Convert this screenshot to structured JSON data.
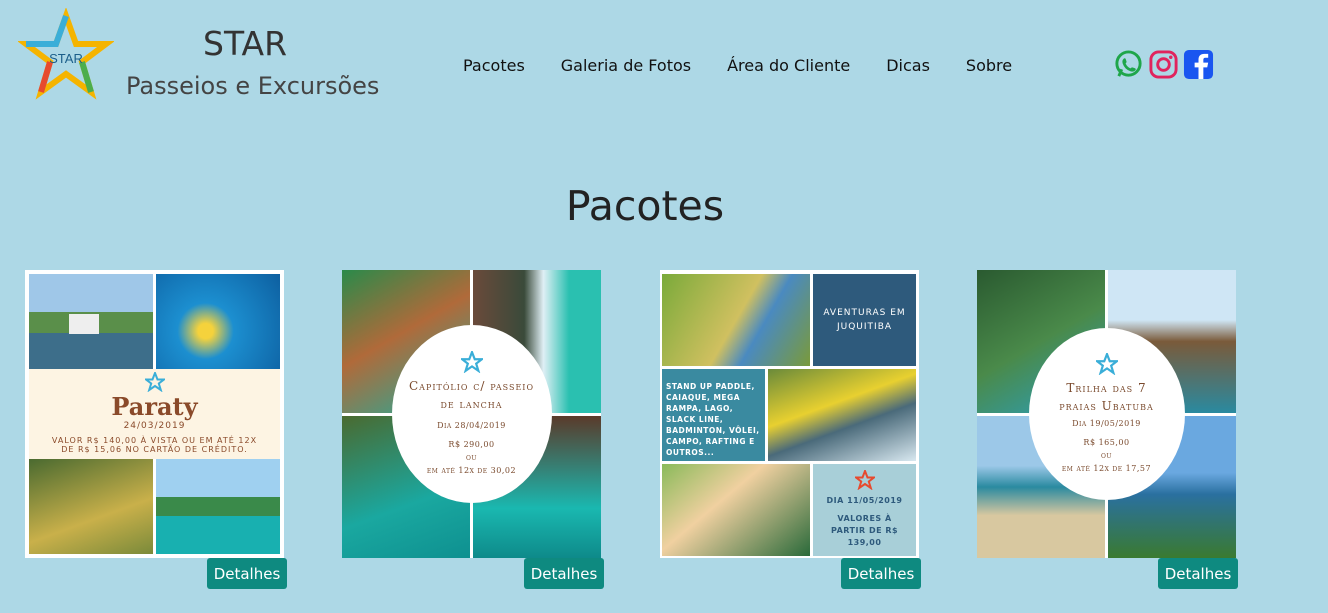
{
  "brand": {
    "logo_text": "STAR",
    "title": "STAR",
    "subtitle": "Passeios e Excursões"
  },
  "nav": {
    "items": [
      {
        "label": "Pacotes"
      },
      {
        "label": "Galeria de Fotos"
      },
      {
        "label": "Área do Cliente"
      },
      {
        "label": "Dicas"
      },
      {
        "label": "Sobre"
      }
    ]
  },
  "social": [
    {
      "icon": "whatsapp-icon",
      "color": "#1fa64a"
    },
    {
      "icon": "instagram-icon",
      "color": "#e0245e"
    },
    {
      "icon": "facebook-icon",
      "color": "#1a56f0"
    }
  ],
  "section": {
    "title": "Pacotes"
  },
  "packages": [
    {
      "title": "Paraty",
      "date": "24/03/2019",
      "price_line1": "VALOR R$ 140,00 À VISTA OU EM ATÉ 12X",
      "price_line2": "DE R$ 15,06 NO CARTÃO DE CRÉDITO.",
      "button": "Detalhes"
    },
    {
      "title": "Capitólio c/ passeio de lancha",
      "date": "Dia 28/04/2019",
      "price": "R$ 290,00",
      "or": "ou",
      "installments": "em até 12x de 30,02",
      "button": "Detalhes"
    },
    {
      "heading": "AVENTURAS EM JUQUITIBA",
      "activities": "STAND UP PADDLE, CAIAQUE, MEGA RAMPA, LAGO, SLACK LINE, BADMINTON, VÔLEI, CAMPO, RAFTING E OUTROS...",
      "date": "DIA 11/05/2019",
      "price": "VALORES À PARTIR DE R$ 139,00",
      "button": "Detalhes"
    },
    {
      "title": "Trilha das 7 praias Ubatuba",
      "date": "Dia 19/05/2019",
      "price": "R$ 165,00",
      "or": "ou",
      "installments": "em até 12x de 17,57",
      "button": "Detalhes"
    }
  ],
  "colors": {
    "background": "#add8e6",
    "button": "#0e8a80",
    "card_text": "#7a4a2d"
  }
}
